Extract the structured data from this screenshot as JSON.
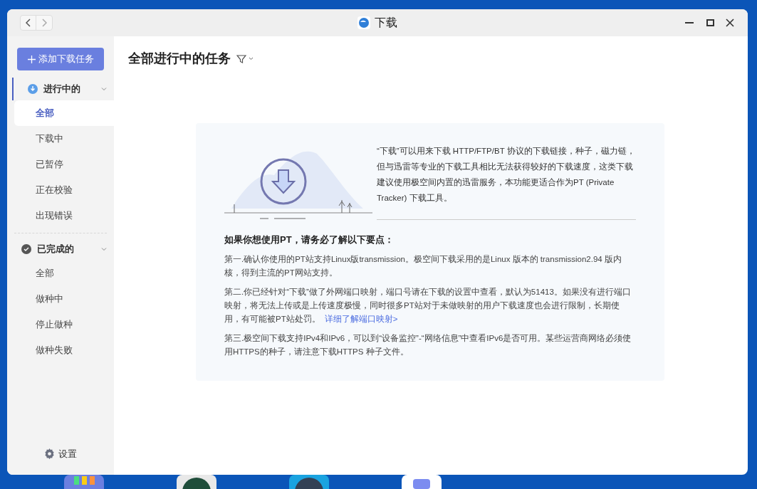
{
  "window": {
    "title": "下载"
  },
  "sidebar": {
    "add_button": "添加下载任务",
    "groups": [
      {
        "label": "进行中的",
        "kind": "downloading",
        "expanded": true,
        "selected": true,
        "items": [
          {
            "label": "全部",
            "selected": true
          },
          {
            "label": "下载中",
            "selected": false
          },
          {
            "label": "已暂停",
            "selected": false
          },
          {
            "label": "正在校验",
            "selected": false
          },
          {
            "label": "出现错误",
            "selected": false
          }
        ]
      },
      {
        "label": "已完成的",
        "kind": "completed",
        "expanded": true,
        "selected": false,
        "items": [
          {
            "label": "全部",
            "selected": false
          },
          {
            "label": "做种中",
            "selected": false
          },
          {
            "label": "停止做种",
            "selected": false
          },
          {
            "label": "做种失败",
            "selected": false
          }
        ]
      }
    ],
    "settings": "设置"
  },
  "main": {
    "heading": "全部进行中的任务",
    "intro": "“下载”可以用来下载 HTTP/FTP/BT 协议的下载链接，种子，磁力链，但与迅雷等专业的下载工具相比无法获得较好的下载速度，这类下载建议使用极空间内置的迅雷服务，本功能更适合作为PT (Private Tracker) 下载工具。",
    "notes_title": "如果你想使用PT，请务必了解以下要点：",
    "notes": [
      {
        "text": "第一.确认你使用的PT站支持Linux版transmission。极空间下载采用的是Linux 版本的 transmission2.94 版内核，得到主流的PT网站支持。"
      },
      {
        "text": "第二.你已经针对“下载”做了外网端口映射，端口号请在下载的设置中查看，默认为51413。如果没有进行端口映射，将无法上传或是上传速度极慢，同时很多PT站对于未做映射的用户下载速度也会进行限制，长期使用，有可能被PT站处罚。",
        "link": "详细了解端口映射>"
      },
      {
        "text": "第三.极空间下载支持IPv4和IPv6，可以到“设备监控”-“网络信息”中查看IPv6是否可用。某些运营商网络必须使用HTTPS的种子，请注意下载HTTPS 种子文件。"
      }
    ]
  }
}
